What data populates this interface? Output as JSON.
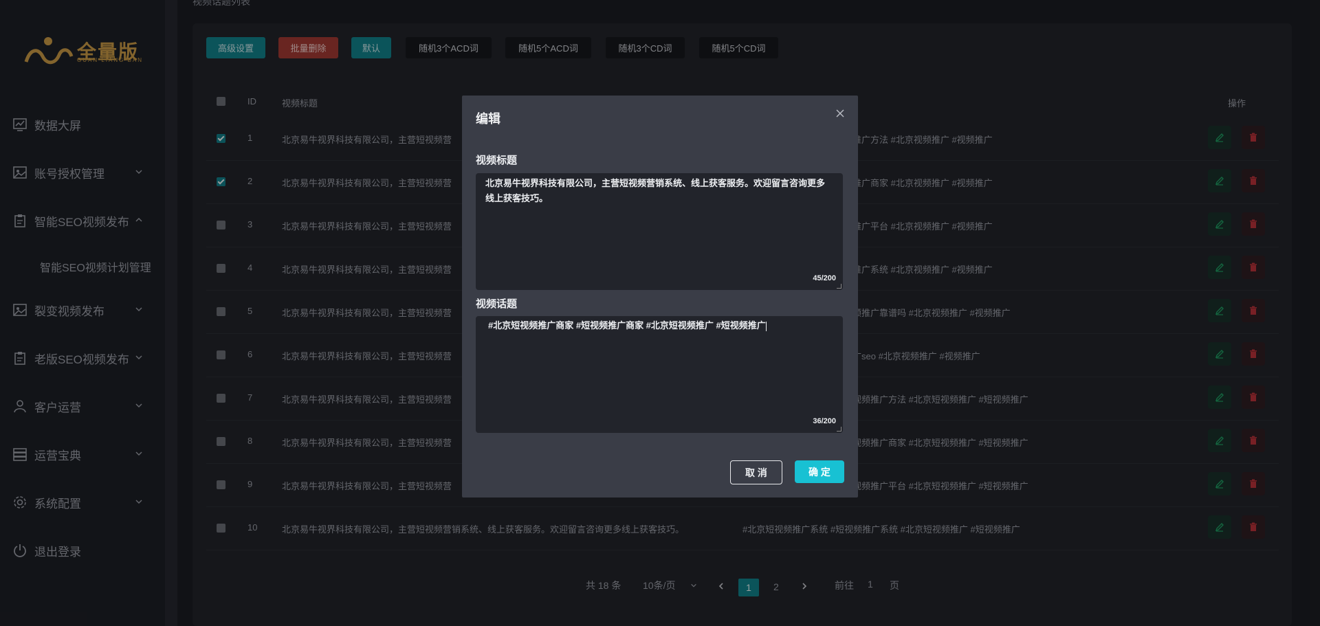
{
  "sidebar": {
    "logo": {
      "title": "全量版",
      "subtitle": "GUAN LIANG BAN"
    },
    "items": [
      {
        "label": "数据大屏",
        "icon": "chart-icon"
      },
      {
        "label": "账号授权管理",
        "icon": "image-icon"
      },
      {
        "label": "智能SEO视频发布",
        "icon": "clipboard-icon"
      },
      {
        "label": "裂变视频发布",
        "icon": "image-icon"
      },
      {
        "label": "老版SEO视频发布",
        "icon": "clipboard-icon"
      },
      {
        "label": "客户运营",
        "icon": "user-icon"
      },
      {
        "label": "运营宝典",
        "icon": "storage-icon"
      },
      {
        "label": "系统配置",
        "icon": "gear-icon"
      },
      {
        "label": "退出登录",
        "icon": "power-icon"
      }
    ],
    "subitem": "智能SEO视频计划管理"
  },
  "panel": {
    "label": "视频话题列表"
  },
  "toolbar": {
    "advanced": "高级设置",
    "batch_delete": "批量删除",
    "default": "默认",
    "rand3acd": "随机3个ACD词",
    "rand5acd": "随机5个ACD词",
    "rand3cd": "随机3个CD词",
    "rand5cd": "随机5个CD词"
  },
  "table": {
    "headers": {
      "id": "ID",
      "title": "视频标题",
      "actions": "操作"
    },
    "rows": [
      {
        "id": "1",
        "title": "北京易牛视界科技有限公司，主营短视频营",
        "topic": "推广方法 #北京视频推广 #视频推广",
        "checked": true
      },
      {
        "id": "2",
        "title": "北京易牛视界科技有限公司，主营短视频营",
        "topic": "推广商家 #北京视频推广 #视频推广",
        "checked": true
      },
      {
        "id": "3",
        "title": "北京易牛视界科技有限公司，主营短视频营",
        "topic": "推广平台 #北京视频推广 #视频推广",
        "checked": false
      },
      {
        "id": "4",
        "title": "北京易牛视界科技有限公司，主营短视频营",
        "topic": "推广系统 #北京视频推广 #视频推广",
        "checked": false
      },
      {
        "id": "5",
        "title": "北京易牛视界科技有限公司，主营短视频营",
        "topic": "频推广靠谱吗 #北京视频推广 #视频推广",
        "checked": false
      },
      {
        "id": "6",
        "title": "北京易牛视界科技有限公司，主营短视频营",
        "topic": "广seo #北京视频推广 #视频推广",
        "checked": false
      },
      {
        "id": "7",
        "title": "北京易牛视界科技有限公司，主营短视频营",
        "topic": "视频推广方法 #北京短视频推广 #短视频推广",
        "checked": false
      },
      {
        "id": "8",
        "title": "北京易牛视界科技有限公司，主营短视频营",
        "topic": "视频推广商家 #北京短视频推广 #短视频推广",
        "checked": false
      },
      {
        "id": "9",
        "title": "北京易牛视界科技有限公司，主营短视频营",
        "topic": "视频推广平台 #北京短视频推广 #短视频推广",
        "checked": false
      },
      {
        "id": "10",
        "title": "北京易牛视界科技有限公司，主营短视频营销系统、线上获客服务。欢迎留言咨询更多线上获客技巧。",
        "topic": "#北京短视频推广系统 #短视频推广系统 #北京短视频推广 #短视频推广",
        "checked": false
      }
    ]
  },
  "pagination": {
    "total": "共 18 条",
    "page_size": "10条/页",
    "pages": [
      "1",
      "2"
    ],
    "goto_label": "前往",
    "goto_value": "1",
    "goto_suffix": "页"
  },
  "modal": {
    "title": "编辑",
    "field1_label": "视频标题",
    "field1_value": "北京易牛视界科技有限公司，主营短视频营销系统、线上获客服务。欢迎留言咨询更多线上获客技巧。",
    "field1_counter": "45/200",
    "field2_label": "视频话题",
    "field2_value": "#北京短视频推广商家 #短视频推广商家 #北京短视频推广 #短视频推广",
    "field2_counter": "36/200",
    "cancel": "取 消",
    "confirm": "确 定"
  },
  "colors": {
    "accent": "#18c1d3",
    "teal": "#11818a",
    "danger": "#a13a34",
    "logo_gold": "#c99a45"
  }
}
